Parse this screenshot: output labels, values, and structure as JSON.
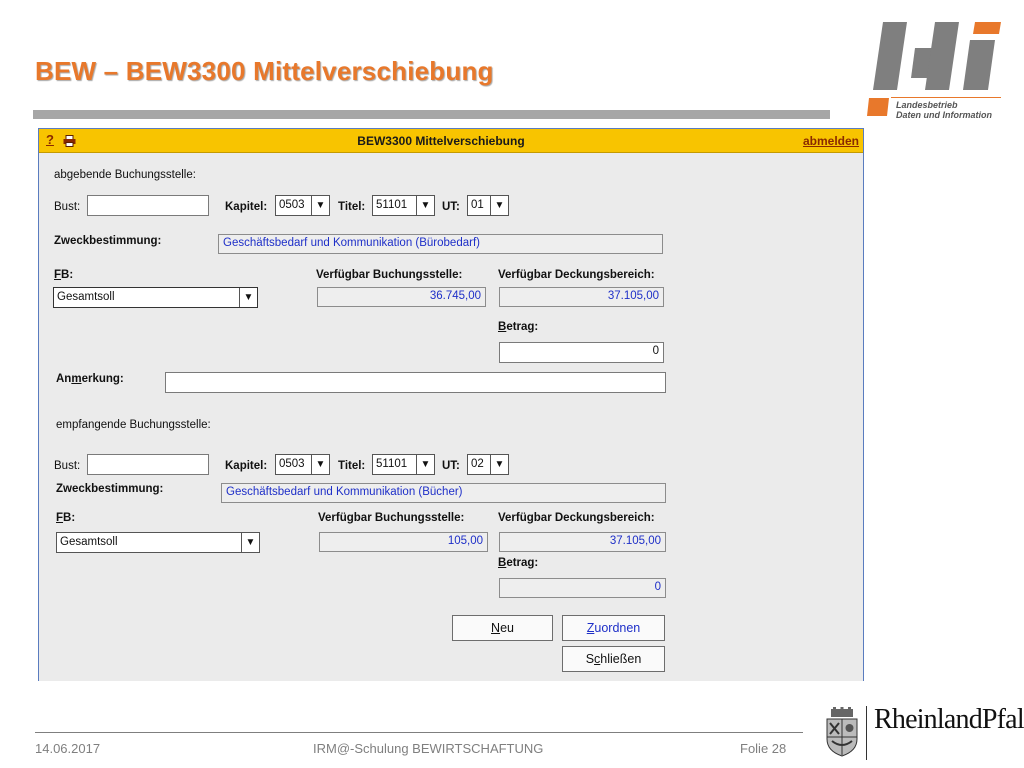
{
  "slide": {
    "title": "BEW – BEW3300 Mittelverschiebung",
    "logo_line1": "Landesbetrieb",
    "logo_line2": "Daten und Information",
    "logo_letters": "ldi"
  },
  "app": {
    "help": "?",
    "title": "BEW3300 Mittelverschiebung",
    "logout": "abmelden",
    "colors": {
      "bar": "#f8c400",
      "link": "#8a2a00",
      "value_text": "#1e2fc8"
    }
  },
  "source": {
    "heading": "abgebende Buchungsstelle:",
    "bust_label": "Bust:",
    "bust_value": "",
    "kapitel_label": "Kapitel:",
    "kapitel_value": "0503",
    "titel_label": "Titel:",
    "titel_value": "51101",
    "ut_label": "UT:",
    "ut_value": "01",
    "zweck_label": "Zweckbestimmung:",
    "zweck_value": "Geschäftsbedarf und Kommunikation (Bürobedarf)",
    "fb_label_u": "F",
    "fb_label_rest": "B:",
    "fb_value": "Gesamtsoll",
    "verf_bst_label": "Verfügbar Buchungsstelle:",
    "verf_bst_value": "36.745,00",
    "verf_deck_label": "Verfügbar Deckungsbereich:",
    "verf_deck_value": "37.105,00",
    "betrag_label_u": "B",
    "betrag_label_rest": "etrag:",
    "betrag_value": "0"
  },
  "remark": {
    "label_a": "An",
    "label_u": "m",
    "label_b": "erkung:",
    "value": ""
  },
  "target": {
    "heading": "empfangende Buchungsstelle:",
    "bust_label": "Bust:",
    "bust_value": "",
    "kapitel_label": "Kapitel:",
    "kapitel_value": "0503",
    "titel_label": "Titel:",
    "titel_value": "51101",
    "ut_label": "UT:",
    "ut_value": "02",
    "zweck_label": "Zweckbestimmung:",
    "zweck_value": "Geschäftsbedarf und Kommunikation (Bücher)",
    "fb_label_u": "F",
    "fb_label_rest": "B:",
    "fb_value": "Gesamtsoll",
    "verf_bst_label": "Verfügbar Buchungsstelle:",
    "verf_bst_value": "105,00",
    "verf_deck_label": "Verfügbar Deckungsbereich:",
    "verf_deck_value": "37.105,00",
    "betrag_label_u": "B",
    "betrag_label_rest": "etrag:",
    "betrag_value": "0"
  },
  "buttons": {
    "neu_u": "N",
    "neu_rest": "eu",
    "zuordnen_u": "Z",
    "zuordnen_rest": "uordnen",
    "schliessen_a": "S",
    "schliessen_u": "c",
    "schliessen_b": "hließen"
  },
  "footer": {
    "date": "14.06.2017",
    "center": "IRM@-Schulung BEWIRTSCHAFTUNG",
    "slide_no": "Folie 28",
    "state_brand": "RheinlandPfalz"
  },
  "icons": {
    "arrow": "▼",
    "print": "printer-icon",
    "coat": "coat-of-arms-icon"
  }
}
